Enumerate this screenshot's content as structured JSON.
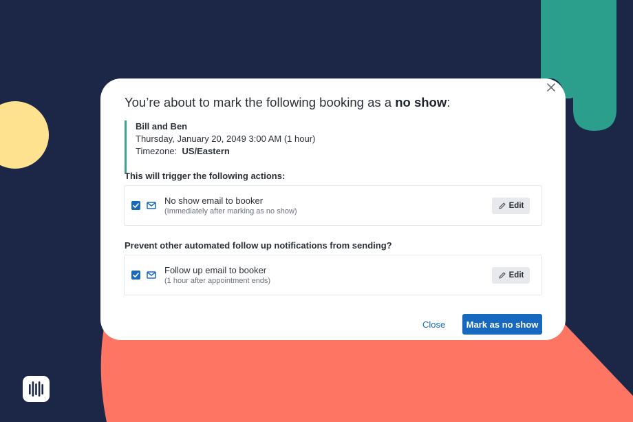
{
  "colors": {
    "background": "#1c2748",
    "accent_teal": "#2b9f8c",
    "accent_yellow": "#ffe28f",
    "accent_coral": "#ff7563",
    "primary": "#1769c0"
  },
  "dialog": {
    "title_prefix": "You’re about to mark the following booking as a ",
    "title_emphasis": "no show",
    "title_suffix": ":",
    "close_icon": "close-icon",
    "booking": {
      "name": "Bill and Ben",
      "datetime": "Thursday, January 20, 2049 3:00 AM (1 hour)",
      "timezone_label": "Timezone:",
      "timezone_value": "US/Eastern"
    },
    "sections": [
      {
        "label": "This will trigger the following actions:",
        "item": {
          "checked": true,
          "icon": "mail-icon",
          "title": "No show email to booker",
          "subtitle": "(Immediately after marking as no show)",
          "edit_label": "Edit"
        }
      },
      {
        "label": "Prevent other automated follow up notifications from sending?",
        "item": {
          "checked": true,
          "icon": "mail-icon",
          "title": "Follow up email to booker",
          "subtitle": "(1 hour after appointment ends)",
          "edit_label": "Edit"
        }
      }
    ],
    "close_label": "Close",
    "confirm_label": "Mark as no show"
  },
  "logo_icon": "brand-logo-icon"
}
